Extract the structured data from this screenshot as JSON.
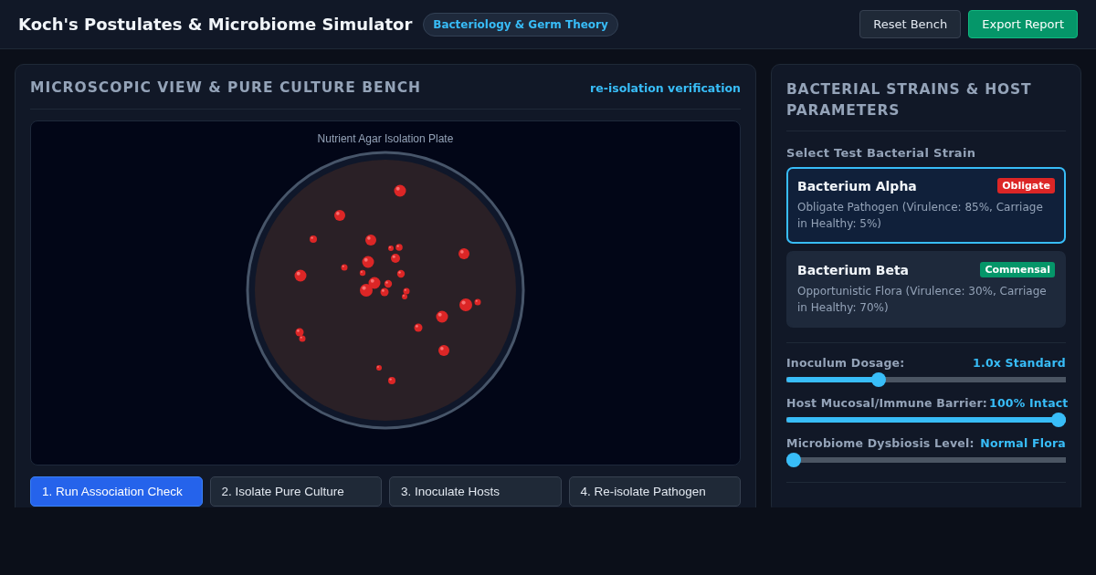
{
  "header": {
    "title": "Koch's Postulates & Microbiome Simulator",
    "badge": "Bacteriology & Germ Theory",
    "buttons": [
      {
        "label": "Reset Bench",
        "kind": "secondary"
      },
      {
        "label": "Export Report",
        "kind": "primary"
      }
    ]
  },
  "bench": {
    "title": "MICROSCOPIC VIEW & PURE CULTURE BENCH",
    "mode": "re-isolation verification",
    "plate_label": "Nutrient Agar Isolation Plate",
    "steps": [
      {
        "label": "1. Run Association Check",
        "selected": true
      },
      {
        "label": "2. Isolate Pure Culture",
        "selected": false
      },
      {
        "label": "3. Inoculate Hosts",
        "selected": false
      },
      {
        "label": "4. Re-isolate Pathogen",
        "selected": false
      }
    ]
  },
  "parameters": {
    "title": "BACTERIAL STRAINS & HOST PARAMETERS",
    "strain_label": "Select Test Bacterial Strain",
    "strains": [
      {
        "name": "Bacterium Alpha",
        "tag": "Obligate",
        "color": "#dc2626",
        "description": "Obligate Pathogen (Virulence: 85%, Carriage in Healthy: 5%)",
        "selected": true
      },
      {
        "name": "Bacterium Beta",
        "tag": "Commensal",
        "color": "#059669",
        "description": "Opportunistic Flora (Virulence: 30%, Carriage in Healthy: 70%)",
        "selected": false
      }
    ],
    "sliders": [
      {
        "label": "Inoculum Dosage:",
        "value": "1.0x Standard",
        "level": 0.32
      },
      {
        "label": "Host Mucosal/Immune Barrier:",
        "value": "100% Intact",
        "level": 1
      },
      {
        "label": "Microbiome Dysbiosis Level:",
        "value": "Normal Flora",
        "level": 0
      }
    ]
  }
}
